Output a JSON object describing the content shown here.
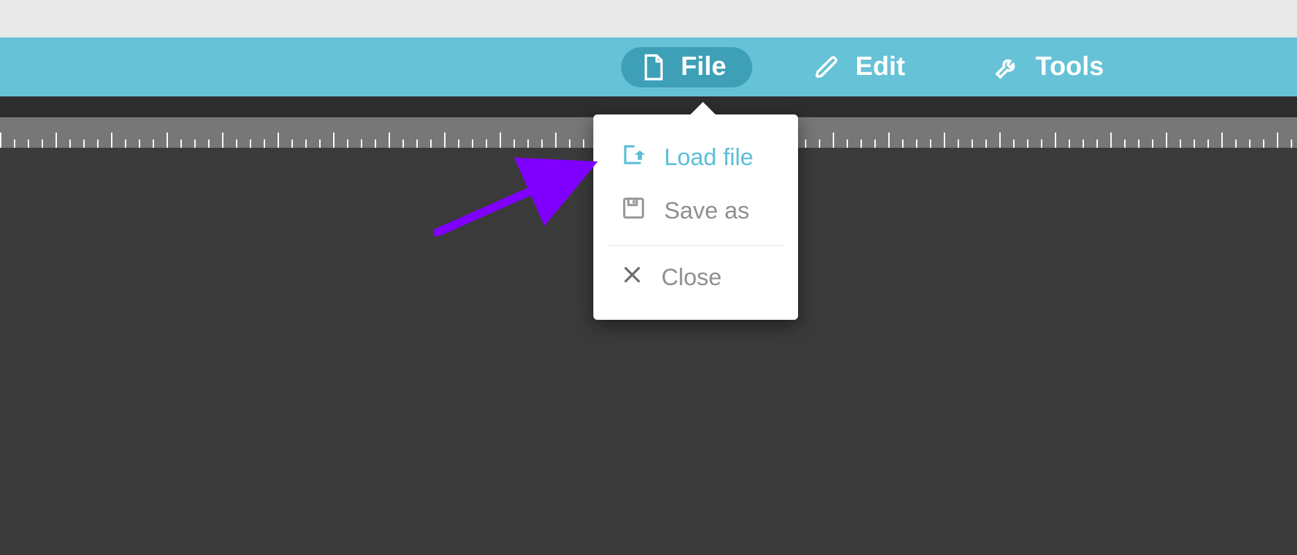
{
  "toolbar": {
    "file_label": "File",
    "edit_label": "Edit",
    "tools_label": "Tools"
  },
  "file_menu": {
    "load_label": "Load file",
    "save_as_label": "Save as",
    "close_label": "Close"
  },
  "annotation": {
    "arrow_color": "#8000ff"
  }
}
